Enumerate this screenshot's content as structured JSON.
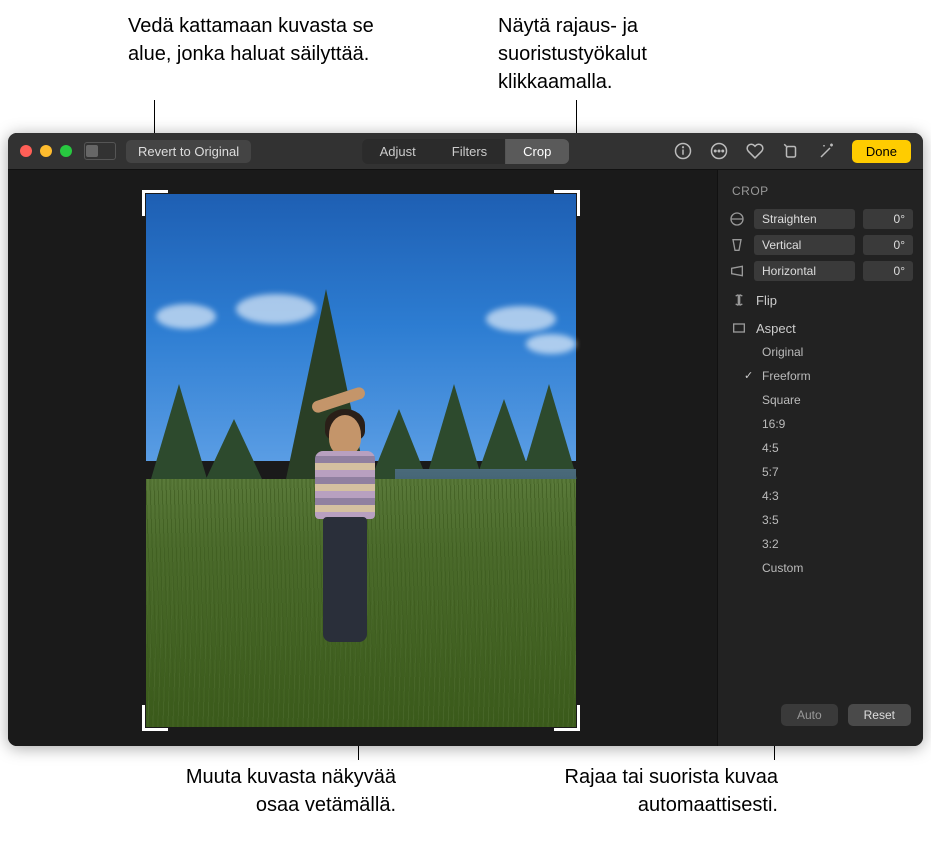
{
  "callouts": {
    "top_left": "Vedä kattamaan kuvasta se alue, jonka haluat säilyttää.",
    "top_right": "Näytä rajaus- ja suoristustyökalut klikkaamalla.",
    "bottom_left_l1": "Muuta kuvasta näkyvää",
    "bottom_left_l2": "osaa vetämällä.",
    "bottom_right_l1": "Rajaa tai suorista kuvaa",
    "bottom_right_l2": "automaattisesti."
  },
  "toolbar": {
    "revert": "Revert to Original",
    "tabs": {
      "adjust": "Adjust",
      "filters": "Filters",
      "crop": "Crop"
    },
    "done": "Done"
  },
  "sidebar": {
    "title": "CROP",
    "sliders": {
      "straighten": {
        "label": "Straighten",
        "value": "0°"
      },
      "vertical": {
        "label": "Vertical",
        "value": "0°"
      },
      "horizontal": {
        "label": "Horizontal",
        "value": "0°"
      }
    },
    "flip": "Flip",
    "aspect": "Aspect",
    "aspects": [
      "Original",
      "Freeform",
      "Square",
      "16:9",
      "4:5",
      "5:7",
      "4:3",
      "3:5",
      "3:2",
      "Custom"
    ],
    "selected_aspect": "Freeform",
    "auto": "Auto",
    "reset": "Reset"
  }
}
